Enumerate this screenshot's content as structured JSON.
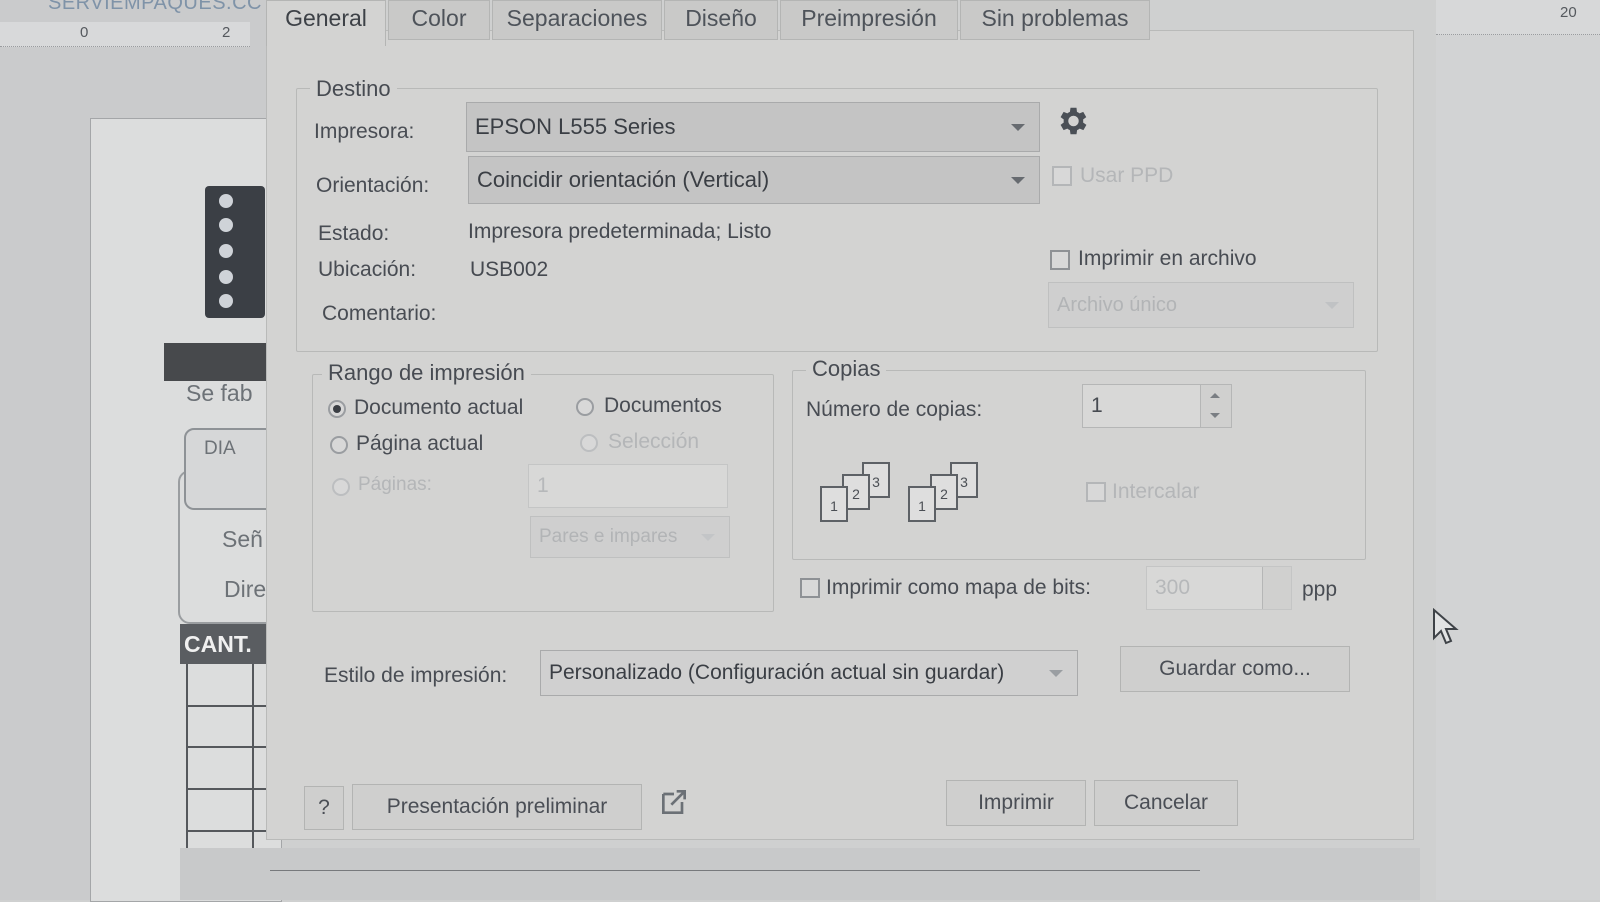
{
  "background_app": {
    "title": "SERVIEMPAQUES.CC",
    "ruler_left": [
      "0",
      "2"
    ],
    "ruler_right": "20",
    "doc_texts": [
      "Se fab",
      "DIA",
      "Señ",
      "Dire",
      "CANT."
    ]
  },
  "tabs": [
    "General",
    "Color",
    "Separaciones",
    "Diseño",
    "Preimpresión",
    "Sin problemas"
  ],
  "destino": {
    "title": "Destino",
    "printer_label": "Impresora:",
    "printer_value": "EPSON L555 Series",
    "orientation_label": "Orientación:",
    "orientation_value": "Coincidir orientación (Vertical)",
    "use_ppd_label": "Usar PPD",
    "status_label": "Estado:",
    "status_value": "Impresora predeterminada; Listo",
    "location_label": "Ubicación:",
    "location_value": "USB002",
    "comment_label": "Comentario:",
    "print_to_file_label": "Imprimir en archivo",
    "file_mode_value": "Archivo único"
  },
  "range": {
    "title": "Rango de impresión",
    "current_document": "Documento actual",
    "documents": "Documentos",
    "current_page": "Página actual",
    "selection": "Selección",
    "pages": "Páginas:",
    "pages_value": "1",
    "even_odd": "Pares e impares"
  },
  "copies": {
    "title": "Copias",
    "number_label": "Número de copias:",
    "number_value": "1",
    "collate_label": "Intercalar",
    "collate_icon_numbers": [
      "1",
      "2",
      "3"
    ]
  },
  "bitmap": {
    "label": "Imprimir como mapa de bits:",
    "dpi_value": "300",
    "unit": "ppp"
  },
  "style": {
    "label": "Estilo de impresión:",
    "value": "Personalizado (Configuración actual sin guardar)",
    "save_as": "Guardar como..."
  },
  "footer": {
    "help": "?",
    "preview": "Presentación preliminar",
    "print": "Imprimir",
    "cancel": "Cancelar"
  }
}
